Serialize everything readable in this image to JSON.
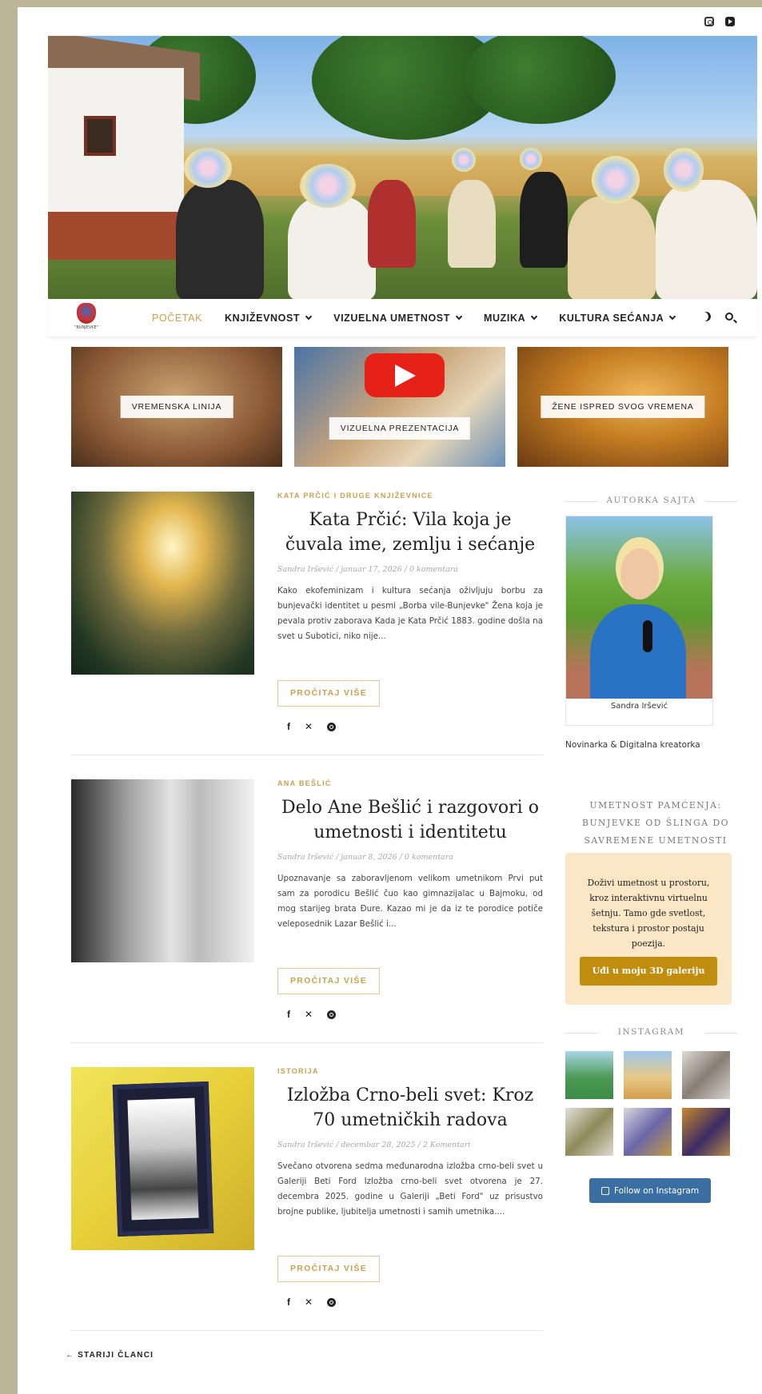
{
  "nav": {
    "items": [
      {
        "label": "POČETAK",
        "active": true,
        "dropdown": false
      },
      {
        "label": "KNJIŽEVNOST",
        "active": false,
        "dropdown": true
      },
      {
        "label": "VIZUELNA UMETNOST",
        "active": false,
        "dropdown": true
      },
      {
        "label": "MUZIKA",
        "active": false,
        "dropdown": true
      },
      {
        "label": "KULTURA SEĆANJA",
        "active": false,
        "dropdown": true
      }
    ],
    "icons": [
      "moon-icon",
      "search-icon"
    ]
  },
  "topbar": {
    "icons": [
      "instagram-icon",
      "youtube-icon"
    ]
  },
  "promos": [
    {
      "label": "VREMENSKA LINIJA"
    },
    {
      "label": "VIZUELNA PREZENTACIJA"
    },
    {
      "label": "ŽENE ISPRED SVOG VREMENA"
    }
  ],
  "posts": [
    {
      "category": "KATA PRČIĆ I DRUGE KNJIŽEVNICE",
      "title": "Kata Prčić: Vila koja je čuvala ime, zemlju i sećanje",
      "meta": "Sandra Iršević / januar 17, 2026 / 0 komentara",
      "excerpt": "Kako ekofeminizam i kultura sećanja oživljuju borbu za bunjevački identitet u pesmi „Borba vile-Bunjevke\" Žena koja je pevala protiv zaborava Kada je Kata Prčić 1883. godine došla na svet u Subotici, niko nije...",
      "read_more": "PROČITAJ VIŠE"
    },
    {
      "category": "ANA BEŠLIĆ",
      "title": "Delo Ane Bešlić i razgovori o umetnosti i identitetu",
      "meta": "Sandra Iršević / januar 8, 2026 / 0 komentara",
      "excerpt": "Upoznavanje sa zaboravljenom velikom umetnikom Prvi put sam za porodicu Bešlić čuo kao gimnazijalac u Bajmoku, od mog starijeg brata Đure. Kazao mi je da iz te porodice potiče veleposednik Lazar Bešlić i...",
      "read_more": "PROČITAJ VIŠE"
    },
    {
      "category": "ISTORIJA",
      "title": "Izložba Crno-beli svet: Kroz 70 umetničkih radova",
      "meta": "Sandra Iršević / decembar 28, 2025 / 2 Komentari",
      "excerpt": "Svečano otvorena sedma međunarodna izložba crno-beli svet u Galeriji Beti Ford Izložba crno-beli svet otvorena je 27. decembra 2025. godine u Galeriji „Beti Ford\" uz prisustvo brojne publike, ljubitelja umetnosti i samih umetnika....",
      "read_more": "PROČITAJ VIŠE"
    }
  ],
  "share_icons": [
    "facebook-icon",
    "x-icon",
    "pinterest-icon"
  ],
  "sidebar": {
    "author_title": "AUTORKA SAJTA",
    "author_name": "Sandra Iršević",
    "author_role": "Novinarka & Digitalna kreatorka",
    "art_title": "UMETNOST PAMĆENJA: BUNJEVKE OD ŠLINGA DO SAVREMENE UMETNOSTI",
    "art_text": "Doživi umetnost u prostoru, kroz interaktivnu virtuelnu šetnju. Tamo gde svetlost, tekstura i prostor postaju poezija.",
    "art_button": "Uđi u moju 3D galeriju",
    "instagram_title": "INSTAGRAM",
    "follow_label": "Follow on Instagram"
  },
  "pagination": {
    "older": "← STARIJI ČLANCI"
  },
  "colors": {
    "accent": "#c9a04d",
    "follow": "#3b6ea3",
    "gallery_bg": "#fbe6c5",
    "gallery_btn": "#c08d0f"
  }
}
